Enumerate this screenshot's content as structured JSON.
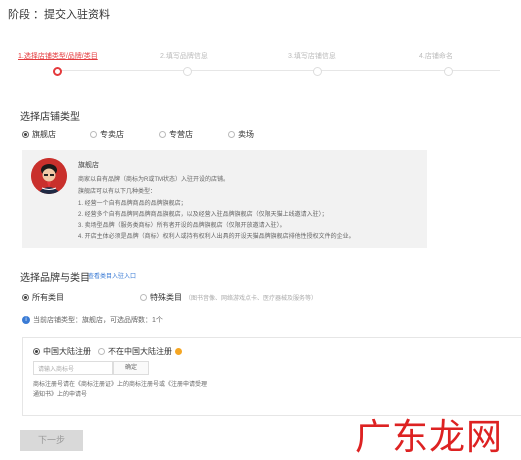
{
  "page_title": "阶段 ：提交入驻资料",
  "steps": [
    {
      "label": "1.选择店铺类型/品牌/类目",
      "active": true
    },
    {
      "label": "2.填写品牌信息",
      "active": false
    },
    {
      "label": "3.填写店铺信息",
      "active": false
    },
    {
      "label": "4.店铺命名",
      "active": false
    }
  ],
  "store_type": {
    "title": "选择店铺类型",
    "options": [
      "旗舰店",
      "专卖店",
      "专营店",
      "卖场"
    ],
    "selected": "旗舰店"
  },
  "info": {
    "name": "旗舰店",
    "lines": [
      "商家以自有品牌（商标为R或TM状态）入驻开设的店铺。",
      "旗舰店可以有以下几种类型：",
      "1. 经营一个自有品牌商品的品牌旗舰店；",
      "2. 经营多个自有品牌同品牌商品旗舰店，以及经营入驻品牌旗舰店（仅限天猫上线邀请入驻）；",
      "3. 卖场型品牌（服务类商标）所有者开设的品牌旗舰店（仅限开放邀请入驻）。",
      "4. 开店主体必须是品牌（商标）权利人或持有权利人出具的开设天猫品牌旗舰店排他性授权文件的企业。"
    ]
  },
  "brand_category": {
    "title": "选择品牌与类目",
    "link": "查看类目入驻入口",
    "options": [
      "所有类目",
      "特殊类目"
    ],
    "special_note": "（图书音像、网络游戏点卡、医疗器械及服务等）",
    "selected": "所有类目",
    "tip": "当前店铺类型：旗舰店，可选品牌数：1个"
  },
  "registration": {
    "options": [
      "中国大陆注册",
      "不在中国大陆注册"
    ],
    "selected": "中国大陆注册",
    "input_placeholder": "请输入商标号",
    "confirm_label": "确定",
    "note_line1": "商标注册号请在《商标注册证》上的商标注册号或《注册申请受理",
    "note_line2": "通知书》上的申请号"
  },
  "next_button": "下一步",
  "watermark": "广东龙网",
  "colors": {
    "accent": "#e4393c",
    "link": "#3a7bd5",
    "tip": "#3a7bd5",
    "warn": "#f5a623"
  }
}
